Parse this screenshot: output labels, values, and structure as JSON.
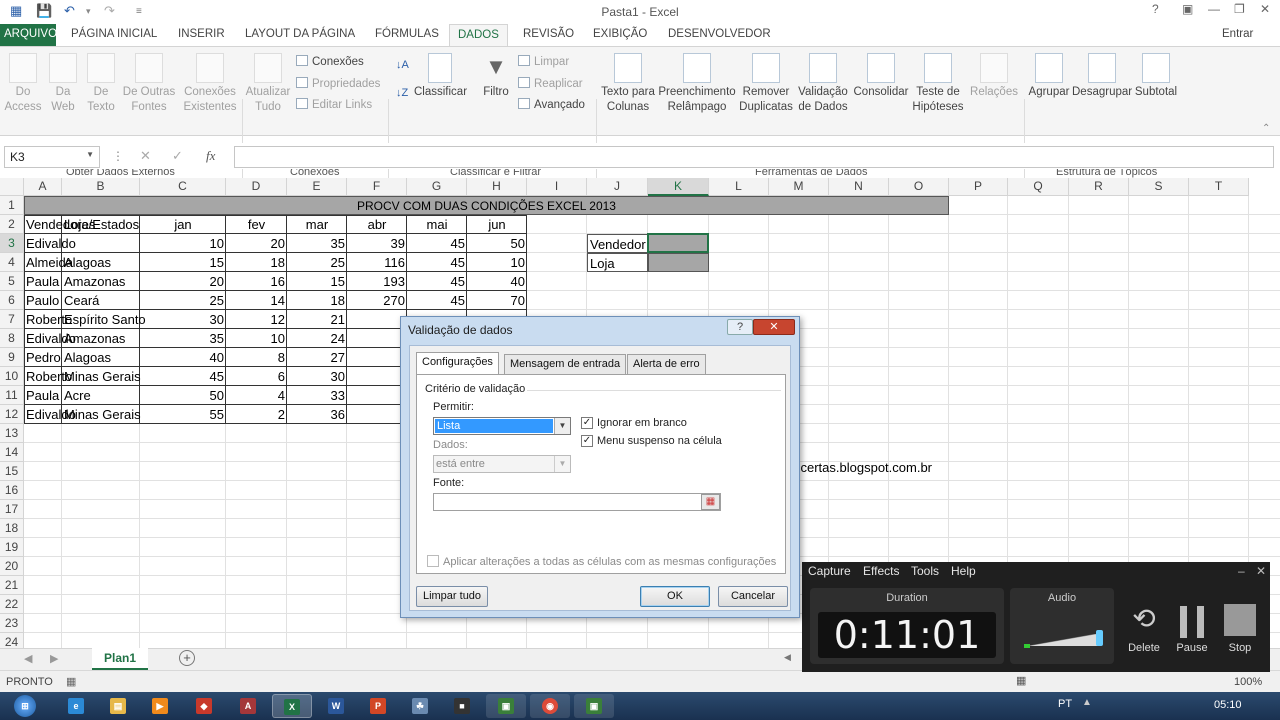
{
  "window": {
    "title": "Pasta1 - Excel",
    "account": "Entrar"
  },
  "tabs": [
    "ARQUIVO",
    "PÁGINA INICIAL",
    "INSERIR",
    "LAYOUT DA PÁGINA",
    "FÓRMULAS",
    "DADOS",
    "REVISÃO",
    "EXIBIÇÃO",
    "DESENVOLVEDOR"
  ],
  "ribbon": {
    "obter": {
      "do_access": "Do\nAccess",
      "da_web": "Da\nWeb",
      "de_texto": "De\nTexto",
      "outras": "De Outras\nFontes",
      "existentes": "Conexões\nExistentes",
      "label": "Obter Dados Externos"
    },
    "conexoes": {
      "atualizar": "Atualizar\nTudo",
      "conexoes": "Conexões",
      "propriedades": "Propriedades",
      "editar": "Editar Links",
      "label": "Conexões"
    },
    "classificar": {
      "classificar": "Classificar",
      "filtro": "Filtro",
      "limpar": "Limpar",
      "reaplicar": "Reaplicar",
      "avancado": "Avançado",
      "label": "Classificar e Filtrar"
    },
    "ferramentas": {
      "texto_colunas": "Texto para\nColunas",
      "preenchimento": "Preenchimento\nRelâmpago",
      "remover": "Remover\nDuplicatas",
      "validacao": "Validação\nde Dados",
      "consolidar": "Consolidar",
      "teste": "Teste de\nHipóteses",
      "relacoes": "Relações",
      "label": "Ferramentas de Dados"
    },
    "estrutura": {
      "agrupar": "Agrupar",
      "desagrupar": "Desagrupar",
      "subtotal": "Subtotal",
      "label": "Estrutura de Tópicos"
    }
  },
  "formula_bar": {
    "name_box": "K3",
    "fx": "fx",
    "formula": ""
  },
  "columns": [
    "A",
    "B",
    "C",
    "D",
    "E",
    "F",
    "G",
    "H",
    "I",
    "J",
    "K",
    "L",
    "M",
    "N",
    "O",
    "P",
    "Q",
    "R",
    "S",
    "T"
  ],
  "rows": [
    "1",
    "2",
    "3",
    "4",
    "5",
    "6",
    "7",
    "8",
    "9",
    "10",
    "11",
    "12",
    "13",
    "14",
    "15",
    "16",
    "17",
    "18",
    "19",
    "20",
    "21",
    "22",
    "23",
    "24"
  ],
  "sheet": {
    "title": "PROCV COM DUAS CONDIÇÕES EXCEL 2013",
    "headers": [
      "Vendedores",
      "Loja/Estados",
      "jan",
      "fev",
      "mar",
      "abr",
      "mai",
      "jun"
    ],
    "data": [
      [
        "Edivaldo",
        "",
        "10",
        "20",
        "35",
        "39",
        "45",
        "50"
      ],
      [
        "Almeida",
        "Alagoas",
        "15",
        "18",
        "25",
        "116",
        "45",
        "10"
      ],
      [
        "Paula",
        "Amazonas",
        "20",
        "16",
        "15",
        "193",
        "45",
        "40"
      ],
      [
        "Paulo",
        "Ceará",
        "25",
        "14",
        "18",
        "270",
        "45",
        "70"
      ],
      [
        "Roberto",
        "Espírito Santo",
        "30",
        "12",
        "21",
        "",
        "",
        ""
      ],
      [
        "Edivaldo",
        "Amazonas",
        "35",
        "10",
        "24",
        "",
        "",
        ""
      ],
      [
        "Pedro",
        "Alagoas",
        "40",
        "8",
        "27",
        "",
        "",
        ""
      ],
      [
        "Roberto",
        "Minas Gerais",
        "45",
        "6",
        "30",
        "",
        "",
        ""
      ],
      [
        "Paula",
        "Acre",
        "50",
        "4",
        "33",
        "",
        "",
        ""
      ],
      [
        "Edivaldo",
        "Minas Gerais",
        "55",
        "2",
        "36",
        "",
        "",
        ""
      ]
    ],
    "lookup": {
      "vendedor": "Vendedor",
      "loja": "Loja"
    },
    "watermark": "scertas.blogspot.com.br"
  },
  "dialog": {
    "title": "Validação de dados",
    "help": "?",
    "close": "✕",
    "tabs": [
      "Configurações",
      "Mensagem de entrada",
      "Alerta de erro"
    ],
    "criterio": "Critério de validação",
    "permitir_label": "Permitir:",
    "permitir_value": "Lista",
    "dados_label": "Dados:",
    "dados_value": "está entre",
    "ignorar": "Ignorar em branco",
    "menu": "Menu suspenso na célula",
    "fonte_label": "Fonte:",
    "fonte_value": "",
    "aplicar": "Aplicar alterações a todas as células com as mesmas configurações",
    "limpar": "Limpar tudo",
    "ok": "OK",
    "cancelar": "Cancelar"
  },
  "sheet_tab": "Plan1",
  "status": {
    "ready": "PRONTO",
    "zoom": "100%"
  },
  "recorder": {
    "menu": [
      "Capture",
      "Effects",
      "Tools",
      "Help"
    ],
    "duration_label": "Duration",
    "duration": "0:11:01",
    "audio_label": "Audio",
    "delete": "Delete",
    "pause": "Pause",
    "stop": "Stop"
  },
  "taskbar": {
    "lang": "PT",
    "time": "05:10"
  }
}
